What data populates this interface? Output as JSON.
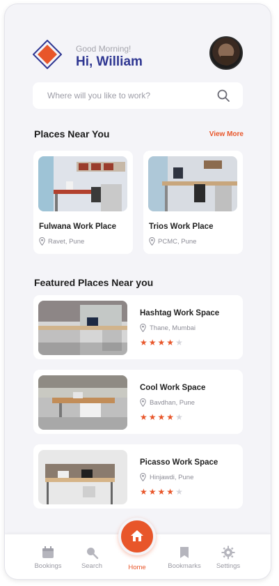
{
  "header": {
    "greeting": "Good Morning!",
    "name_line": "Hi, William"
  },
  "search": {
    "placeholder": "Where will you like to work?"
  },
  "near": {
    "title": "Places Near You",
    "view_more": "View More",
    "items": [
      {
        "name": "Fulwana Work Place",
        "location": "Ravet, Pune"
      },
      {
        "name": "Trios Work Place",
        "location": "PCMC, Pune"
      }
    ]
  },
  "featured": {
    "title": "Featured Places Near you",
    "items": [
      {
        "name": "Hashtag Work Space",
        "location": "Thane, Mumbai",
        "rating": 4,
        "max_rating": 5
      },
      {
        "name": "Cool Work Space",
        "location": "Bavdhan, Pune",
        "rating": 4,
        "max_rating": 5
      },
      {
        "name": "Picasso Work Space",
        "location": "Hinjawdi, Pune",
        "rating": 4,
        "max_rating": 5
      }
    ]
  },
  "nav": {
    "items": [
      {
        "label": "Bookings",
        "icon": "calendar-icon"
      },
      {
        "label": "Search",
        "icon": "search-icon"
      },
      {
        "label": "Home",
        "icon": "home-icon"
      },
      {
        "label": "Bookmarks",
        "icon": "bookmark-icon"
      },
      {
        "label": "Settings",
        "icon": "gear-icon"
      }
    ],
    "active": "Home"
  },
  "colors": {
    "accent": "#e8562a",
    "brand_text": "#2f3792",
    "background": "#f4f4f8"
  }
}
